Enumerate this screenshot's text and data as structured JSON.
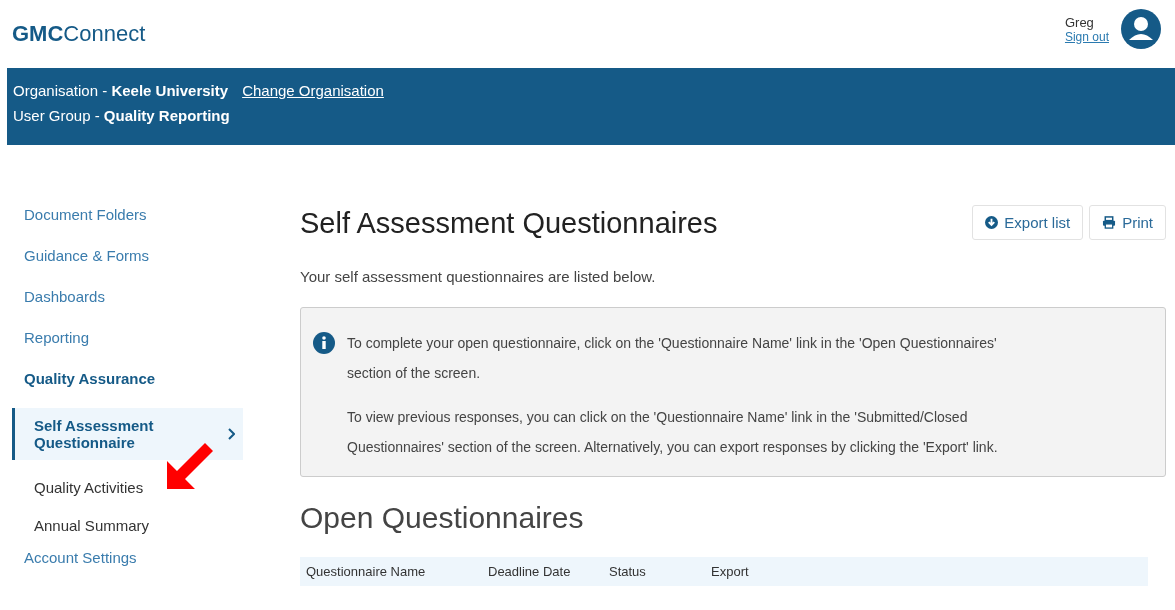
{
  "header": {
    "logo": "**GMC**Connect",
    "user": {
      "name": "Greg",
      "sign_out": "Sign out"
    }
  },
  "banner": {
    "organisation": "Organisation - **Keele University**",
    "change_link": "Change Organisation",
    "user_group": "User Group - **Quality Reporting**"
  },
  "sidebar": {
    "items": [
      {
        "label": "Document Folders",
        "selected": false
      },
      {
        "label": "Guidance & Forms",
        "selected": false
      },
      {
        "label": "Dashboards",
        "selected": false
      },
      {
        "label": "Reporting",
        "selected": false
      },
      {
        "label": "Quality Assurance",
        "selected": true,
        "children": [
          {
            "label": "Self Assessment Questionnaire",
            "selected": true
          },
          {
            "label": "Quality Activities",
            "selected": false
          },
          {
            "label": "Annual Summary",
            "selected": false
          }
        ]
      },
      {
        "label": "Account Settings",
        "selected": false
      }
    ]
  },
  "annotation": {
    "kind": "arrow"
  },
  "page": {
    "title": "Self Assessment Questionnaires",
    "buttons": [
      {
        "label": "Export list",
        "kind": "export"
      },
      {
        "label": "Print",
        "kind": "print"
      }
    ],
    "intro": "Your self assessment questionnaires are listed below.",
    "info": [
      "To complete your open questionnaire, click on the 'Questionnaire Name' link in the 'Open Questionnaires' section of the screen.",
      "To view previous responses, you can click on the 'Questionnaire Name' link in the 'Submitted/Closed Questionnaires' section of the screen. Alternatively, you can export responses by clicking the 'Export' link."
    ],
    "section_title": "Open Questionnaires",
    "table": {
      "columns": [
        "Questionnaire Name",
        "Deadline Date",
        "Status",
        "Export"
      ]
    }
  }
}
